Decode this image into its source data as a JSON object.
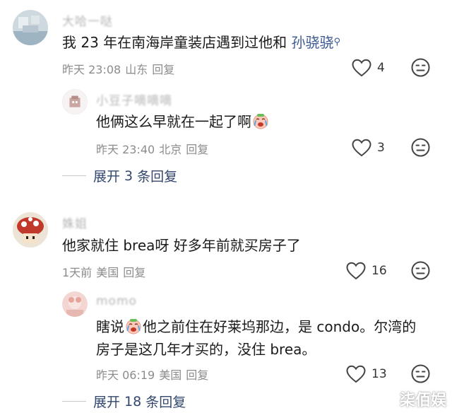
{
  "comments": [
    {
      "username": "大哈一哒",
      "text_before": "我 23 年在南海岸童装店遇到过他和 ",
      "mention": "孙骁骁",
      "time": "昨天 23:08",
      "location": "山东",
      "reply_label": "回复",
      "likes": "4"
    },
    {
      "username": "小豆子嘀嘀嘀",
      "text": "他俩这么早就在一起了啊",
      "time": "昨天 23:40",
      "location": "北京",
      "reply_label": "回复",
      "likes": "3",
      "emoji": "crying-face"
    },
    {
      "username": "姝姐",
      "text": "他家就住 brea呀 好多年前就买房子了",
      "time": "1天前",
      "location": "美国",
      "reply_label": "回复",
      "likes": "16"
    },
    {
      "username": "momo",
      "text_a": "瞎说",
      "text_b": "他之前住在好莱坞那边，是 condo。尔湾的",
      "text_c": "房子是这几年才买的，没住 brea。",
      "time": "昨天 06:19",
      "location": "美国",
      "reply_label": "回复",
      "likes": "13",
      "emoji": "crying-face"
    }
  ],
  "expand_1": {
    "prefix": "展开",
    "count": "3",
    "suffix": "条回复"
  },
  "expand_2": {
    "prefix": "展开",
    "count": "18",
    "suffix": "条回复"
  },
  "watermark": "柒佰娱",
  "colors": {
    "link": "#3e5a93",
    "meta": "#8c8c8c",
    "expand": "#33476e",
    "username": "#b4b4b4"
  }
}
